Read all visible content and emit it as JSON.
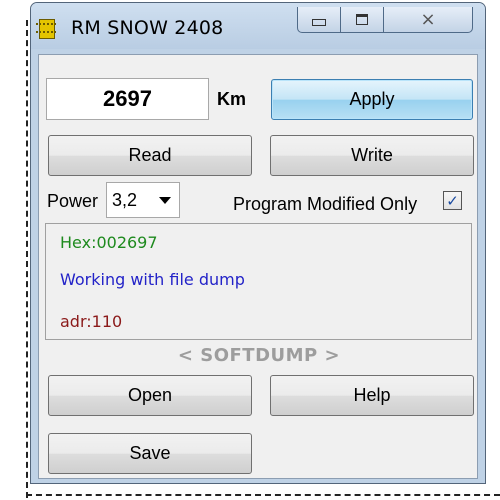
{
  "window": {
    "title": "RM SNOW 2408",
    "icon": "chip-icon",
    "controls": {
      "minimize": "minimize-icon",
      "maximize": "maximize-icon",
      "close": "×"
    }
  },
  "distance": {
    "value": "2697",
    "unit": "Km"
  },
  "buttons": {
    "apply": "Apply",
    "read": "Read",
    "write": "Write",
    "open": "Open",
    "help": "Help",
    "save": "Save"
  },
  "power": {
    "label": "Power",
    "selected": "3,2"
  },
  "program_modified_only": {
    "label": "Program Modified Only",
    "checked": true,
    "check_glyph": "✓"
  },
  "log": {
    "lines": [
      {
        "text": "Hex:002697",
        "color": "#1e8a1e"
      },
      {
        "text": "Working with file dump",
        "color": "#2323c8"
      },
      {
        "text": "adr:110",
        "color": "#8b1a1a"
      }
    ]
  },
  "footer": {
    "brand": "< SOFTDUMP >"
  },
  "colors": {
    "titlebar": "#bfd2e6",
    "client": "#f0f0f0",
    "apply_accent": "#98d1ef"
  }
}
